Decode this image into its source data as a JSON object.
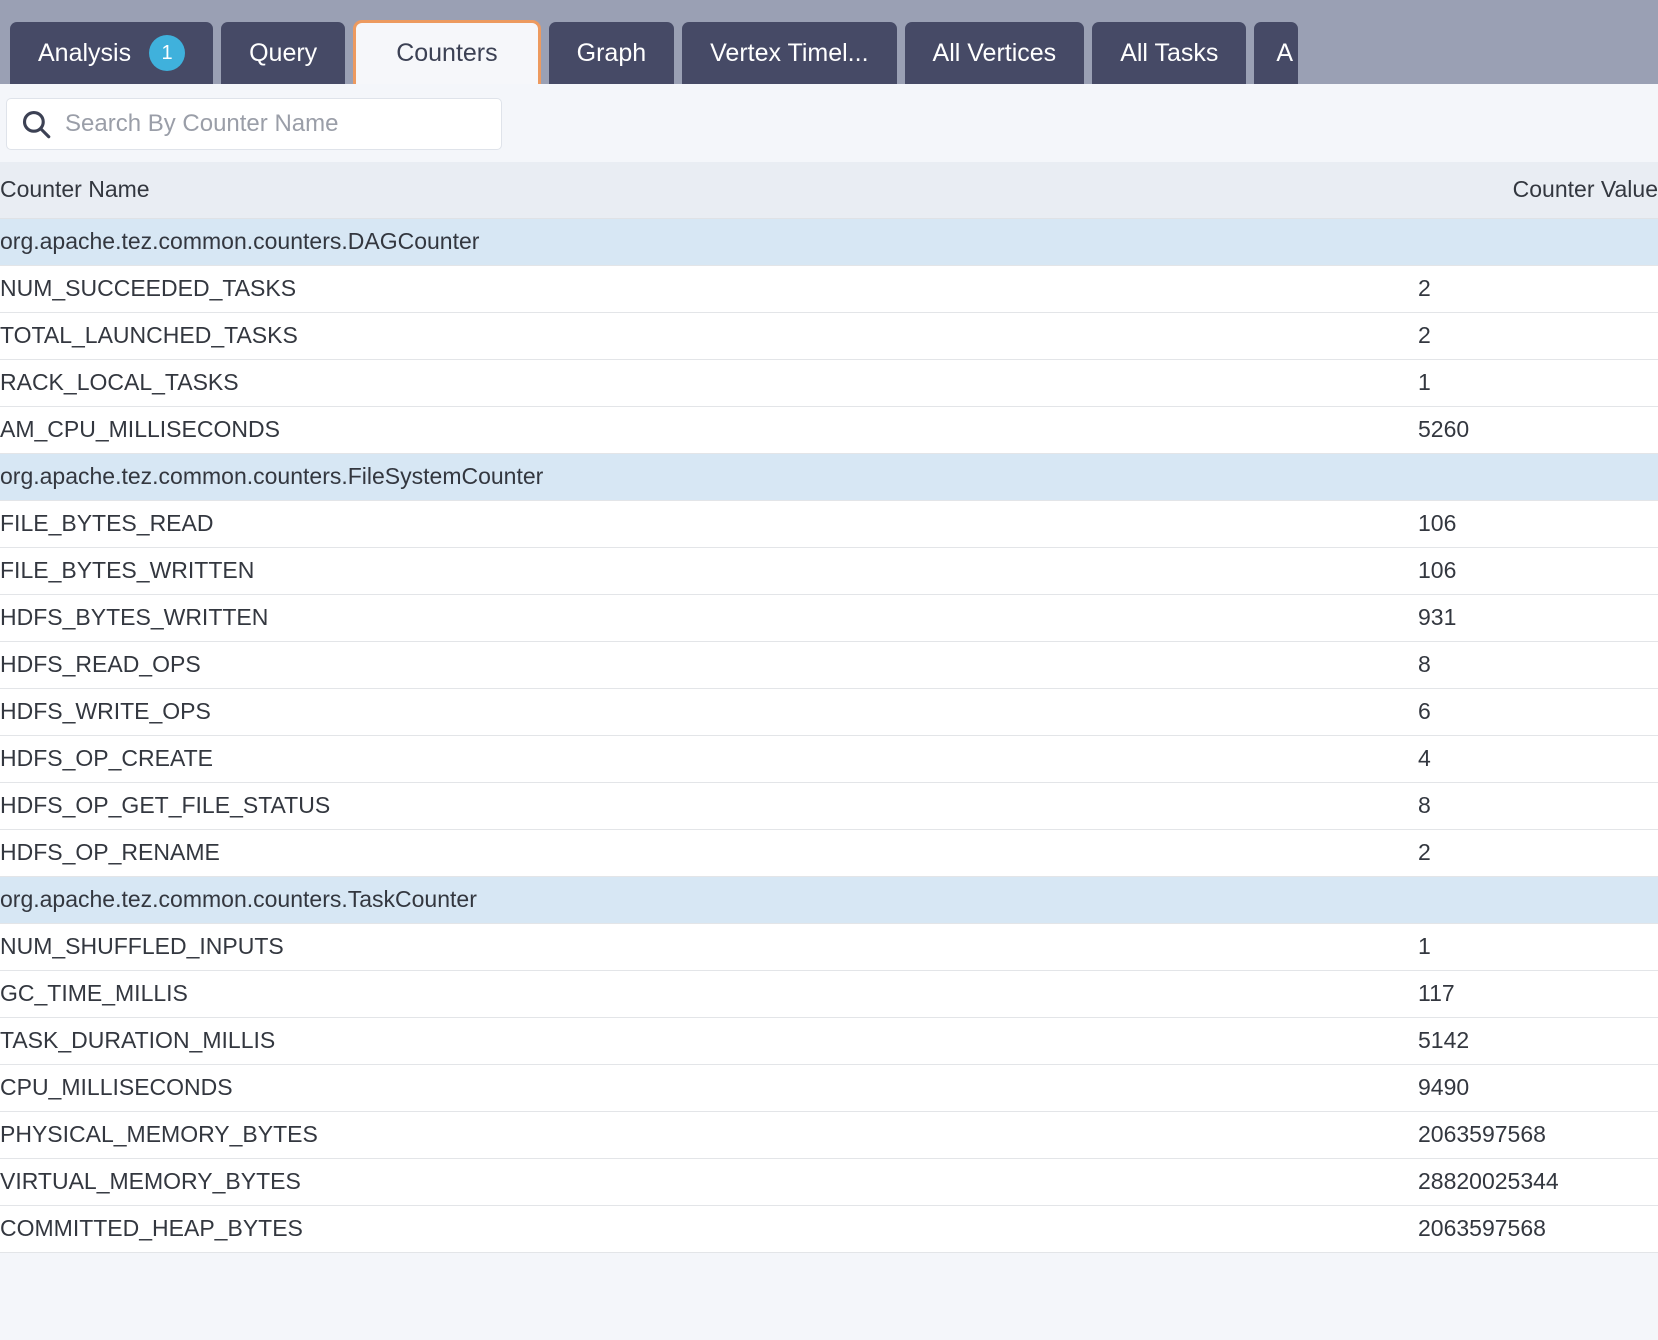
{
  "tabs": [
    {
      "label": "Analysis",
      "badge": "1",
      "active": false,
      "partial": false
    },
    {
      "label": "Query",
      "badge": null,
      "active": false,
      "partial": false
    },
    {
      "label": "Counters",
      "badge": null,
      "active": true,
      "partial": false
    },
    {
      "label": "Graph",
      "badge": null,
      "active": false,
      "partial": false
    },
    {
      "label": "Vertex Timel...",
      "badge": null,
      "active": false,
      "partial": false
    },
    {
      "label": "All Vertices",
      "badge": null,
      "active": false,
      "partial": false
    },
    {
      "label": "All Tasks",
      "badge": null,
      "active": false,
      "partial": false
    },
    {
      "label": "A",
      "badge": null,
      "active": false,
      "partial": true
    }
  ],
  "search": {
    "placeholder": "Search By Counter Name",
    "value": "",
    "icon": "search-icon"
  },
  "table": {
    "columns": [
      "Counter Name",
      "Counter Value"
    ],
    "rows": [
      {
        "type": "group",
        "name": "org.apache.tez.common.counters.DAGCounter",
        "value": ""
      },
      {
        "type": "data",
        "name": "NUM_SUCCEEDED_TASKS",
        "value": "2"
      },
      {
        "type": "data",
        "name": "TOTAL_LAUNCHED_TASKS",
        "value": "2"
      },
      {
        "type": "data",
        "name": "RACK_LOCAL_TASKS",
        "value": "1"
      },
      {
        "type": "data",
        "name": "AM_CPU_MILLISECONDS",
        "value": "5260"
      },
      {
        "type": "group",
        "name": "org.apache.tez.common.counters.FileSystemCounter",
        "value": ""
      },
      {
        "type": "data",
        "name": "FILE_BYTES_READ",
        "value": "106"
      },
      {
        "type": "data",
        "name": "FILE_BYTES_WRITTEN",
        "value": "106"
      },
      {
        "type": "data",
        "name": "HDFS_BYTES_WRITTEN",
        "value": "931"
      },
      {
        "type": "data",
        "name": "HDFS_READ_OPS",
        "value": "8"
      },
      {
        "type": "data",
        "name": "HDFS_WRITE_OPS",
        "value": "6"
      },
      {
        "type": "data",
        "name": "HDFS_OP_CREATE",
        "value": "4"
      },
      {
        "type": "data",
        "name": "HDFS_OP_GET_FILE_STATUS",
        "value": "8"
      },
      {
        "type": "data",
        "name": "HDFS_OP_RENAME",
        "value": "2"
      },
      {
        "type": "group",
        "name": "org.apache.tez.common.counters.TaskCounter",
        "value": ""
      },
      {
        "type": "data",
        "name": "NUM_SHUFFLED_INPUTS",
        "value": "1"
      },
      {
        "type": "data",
        "name": "GC_TIME_MILLIS",
        "value": "117"
      },
      {
        "type": "data",
        "name": "TASK_DURATION_MILLIS",
        "value": "5142"
      },
      {
        "type": "data",
        "name": "CPU_MILLISECONDS",
        "value": "9490"
      },
      {
        "type": "data",
        "name": "PHYSICAL_MEMORY_BYTES",
        "value": "2063597568"
      },
      {
        "type": "data",
        "name": "VIRTUAL_MEMORY_BYTES",
        "value": "28820025344"
      },
      {
        "type": "data",
        "name": "COMMITTED_HEAP_BYTES",
        "value": "2063597568"
      }
    ]
  },
  "colors": {
    "tabbar_bg": "#9aa0b4",
    "tab_bg": "#464a66",
    "tab_active_border": "#ed9a5f",
    "badge_bg": "#3fb1dc",
    "header_bg": "#e9edf3",
    "group_row_bg": "#d7e7f4",
    "page_bg": "#f4f6fa"
  }
}
